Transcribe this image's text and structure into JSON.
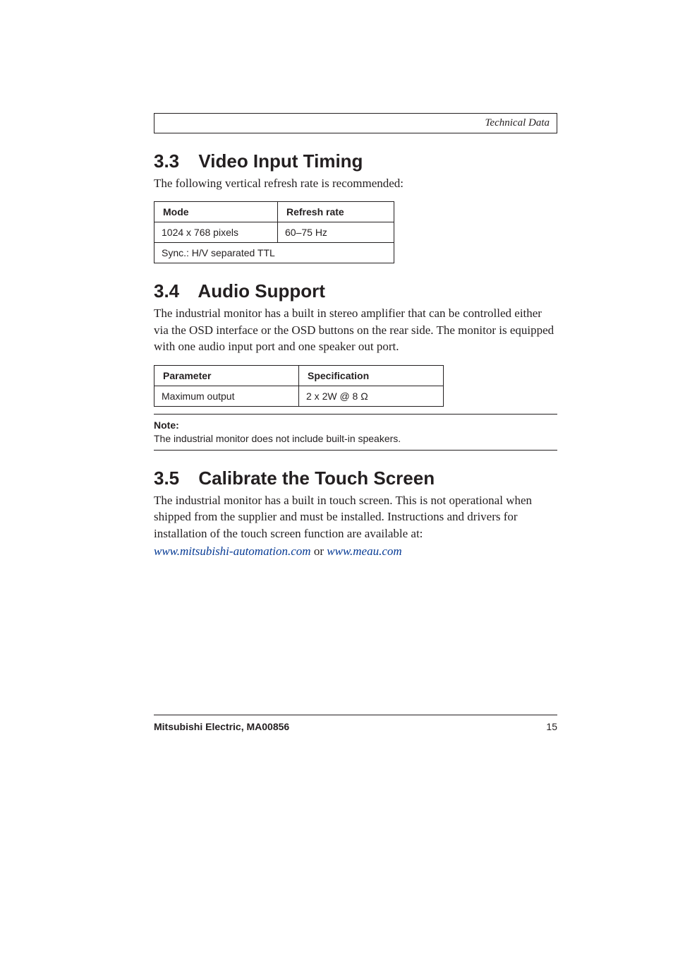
{
  "header": {
    "title": "Technical Data"
  },
  "sec33": {
    "number": "3.3",
    "title": "Video Input Timing",
    "intro": "The following vertical refresh rate is recommended:",
    "table": {
      "headers": [
        "Mode",
        "Refresh rate"
      ],
      "row": [
        "1024 x 768 pixels",
        "60–75 Hz"
      ],
      "span_row": "Sync.: H/V separated TTL"
    }
  },
  "sec34": {
    "number": "3.4",
    "title": "Audio Support",
    "intro": "The industrial monitor has a built in stereo amplifier that can be controlled either via the OSD interface or the OSD buttons on the rear side. The monitor is equipped with one audio input port and one speaker out port.",
    "table": {
      "headers": [
        "Parameter",
        "Specification"
      ],
      "row": [
        "Maximum output",
        "2 x 2W @ 8 Ω"
      ]
    },
    "note": {
      "label": "Note:",
      "text": "The industrial monitor does not include built-in speakers."
    }
  },
  "sec35": {
    "number": "3.5",
    "title": "Calibrate the Touch Screen",
    "intro": "The industrial monitor has a built in touch screen. This is not operational when shipped from the supplier and must be installed. Instructions and drivers for installation of the touch screen function are available at:",
    "link1": "www.mitsubishi-automation.com",
    "connector": " or ",
    "link2": "www.meau.com"
  },
  "footer": {
    "left": "Mitsubishi Electric, MA00856",
    "page": "15"
  }
}
